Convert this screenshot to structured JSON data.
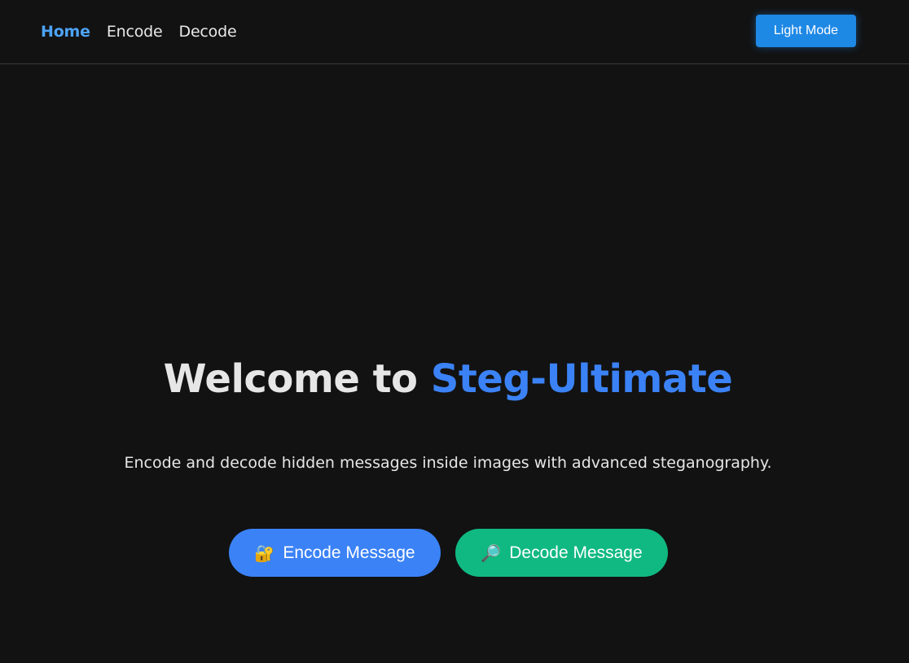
{
  "nav": {
    "links": [
      {
        "label": "Home",
        "active": true
      },
      {
        "label": "Encode",
        "active": false
      },
      {
        "label": "Decode",
        "active": false
      }
    ],
    "theme_toggle_label": "Light Mode"
  },
  "hero": {
    "title_prefix": "Welcome to ",
    "title_brand": "Steg-Ultimate",
    "subtitle": "Encode and decode hidden messages inside images with advanced steganography."
  },
  "actions": {
    "encode": {
      "icon": "lock-with-key-icon",
      "glyph": "🔐",
      "label": "Encode Message"
    },
    "decode": {
      "icon": "magnifying-glass-icon",
      "glyph": "🔎",
      "label": "Decode Message"
    }
  },
  "colors": {
    "background": "#121212",
    "accent_blue": "#3b82f6",
    "nav_active": "#4da3f7",
    "toggle_blue": "#1e88e5",
    "accent_green": "#10b981",
    "text": "#e6e6e6"
  }
}
